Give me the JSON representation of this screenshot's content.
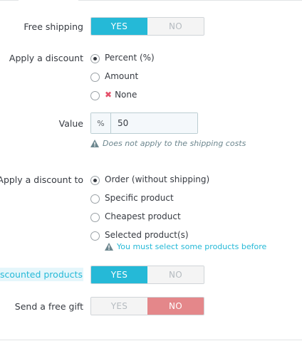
{
  "free_shipping": {
    "label": "Free shipping",
    "yes": "YES",
    "no": "NO",
    "selected": "yes"
  },
  "apply_discount": {
    "label": "Apply a discount",
    "options": [
      {
        "text": "Percent (%)",
        "checked": true
      },
      {
        "text": "Amount",
        "checked": false
      },
      {
        "text": "None",
        "checked": false,
        "icon": "x-mark-icon"
      }
    ]
  },
  "value": {
    "label": "Value",
    "addon": "%",
    "value": "50",
    "help": "Does not apply to the shipping costs"
  },
  "apply_discount_to": {
    "label": "Apply a discount to",
    "options": [
      {
        "text": "Order (without shipping)",
        "checked": true
      },
      {
        "text": "Specific product",
        "checked": false
      },
      {
        "text": "Cheapest product",
        "checked": false
      },
      {
        "text": "Selected product(s)",
        "checked": false
      }
    ],
    "warning": "You must select some products before"
  },
  "discounted_products": {
    "label": "scounted products",
    "yes": "YES",
    "no": "NO",
    "selected": "yes"
  },
  "free_gift": {
    "label": "Send a free gift",
    "yes": "YES",
    "no": "NO",
    "selected": "no"
  },
  "colors": {
    "accent": "#25b9d7",
    "danger": "#e4878a",
    "text": "#363a41",
    "muted": "#6c868e"
  }
}
